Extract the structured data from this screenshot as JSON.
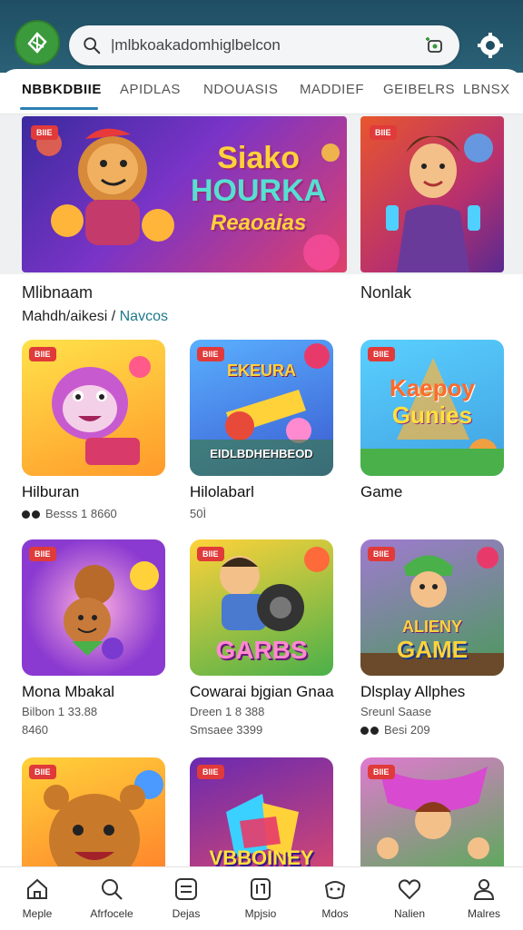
{
  "header": {
    "search_value": "|mlbkoakadomhiglbelcon"
  },
  "tabs": [
    {
      "label": "NBBKDBIIE",
      "active": true
    },
    {
      "label": "APIDLAS",
      "active": false
    },
    {
      "label": "NDOUASIS",
      "active": false
    },
    {
      "label": "MADDIEF",
      "active": false
    },
    {
      "label": "GEIBELRS",
      "active": false
    },
    {
      "label": "LBNSX",
      "active": false
    }
  ],
  "banners": [
    {
      "badge": "BIIE",
      "title_l1": "Siako",
      "title_l2": "HOURKA",
      "title_l3": "Reaoaias"
    },
    {
      "badge": "BIIE"
    }
  ],
  "featured": {
    "left_label": "Mlibnaam",
    "right_label": "Nonlak",
    "sub_text": "Mahdh/aikesi /",
    "sub_accent": "Navcos"
  },
  "games": [
    {
      "badge": "BIIE",
      "art_text": "",
      "title": "Hilburan",
      "meta1": "Besss 1 8660",
      "meta1_dot": true,
      "meta2": ""
    },
    {
      "badge": "BIIE",
      "art_text": "EKEURA",
      "art_sub": "EIDLBDHEHBEOD",
      "title": "Hilolabarl",
      "meta1": "50Ì",
      "meta1_dot": false,
      "meta2": ""
    },
    {
      "badge": "BIIE",
      "art_text": "Kaepoy",
      "art_sub": "Gunies",
      "title": "Game",
      "meta1": "",
      "meta1_dot": false,
      "meta2": ""
    },
    {
      "badge": "BIIE",
      "art_text": "",
      "title": "Mona Mbakal",
      "meta1": "Bilbon 1 33.88",
      "meta1_dot": false,
      "meta2": "8460"
    },
    {
      "badge": "BIIE",
      "art_text": "GARBS",
      "title": "Cowarai bjgian Gnaa",
      "meta1": "Dreen 1 8 388",
      "meta1_dot": false,
      "meta2": "Smsaee 3399"
    },
    {
      "badge": "BIIE",
      "art_text": "ALIENY",
      "art_sub": "GAME",
      "title": "Dlsplay Allphes",
      "meta1": "Sreunl Saase",
      "meta1_dot": false,
      "meta2": "Besi 209",
      "meta2_dot": true
    },
    {
      "badge": "BIIE",
      "art_text": ""
    },
    {
      "badge": "BIIE",
      "art_text": "VBBOINEY"
    },
    {
      "badge": "BIIE",
      "art_text": ""
    }
  ],
  "bottom_nav": [
    {
      "label": "Meple",
      "icon": "home-icon"
    },
    {
      "label": "Afrfocele",
      "icon": "search-icon"
    },
    {
      "label": "Dejas",
      "icon": "list-icon"
    },
    {
      "label": "Mpjsio",
      "icon": "app-icon"
    },
    {
      "label": "Mdos",
      "icon": "game-icon"
    },
    {
      "label": "Nalien",
      "icon": "heart-icon"
    },
    {
      "label": "Malres",
      "icon": "profile-icon"
    }
  ],
  "colors": {
    "header_bg": "#1f4e63",
    "accent": "#2a7fb5",
    "badge": "#e03a3a",
    "logo": "#3a9a3c"
  }
}
